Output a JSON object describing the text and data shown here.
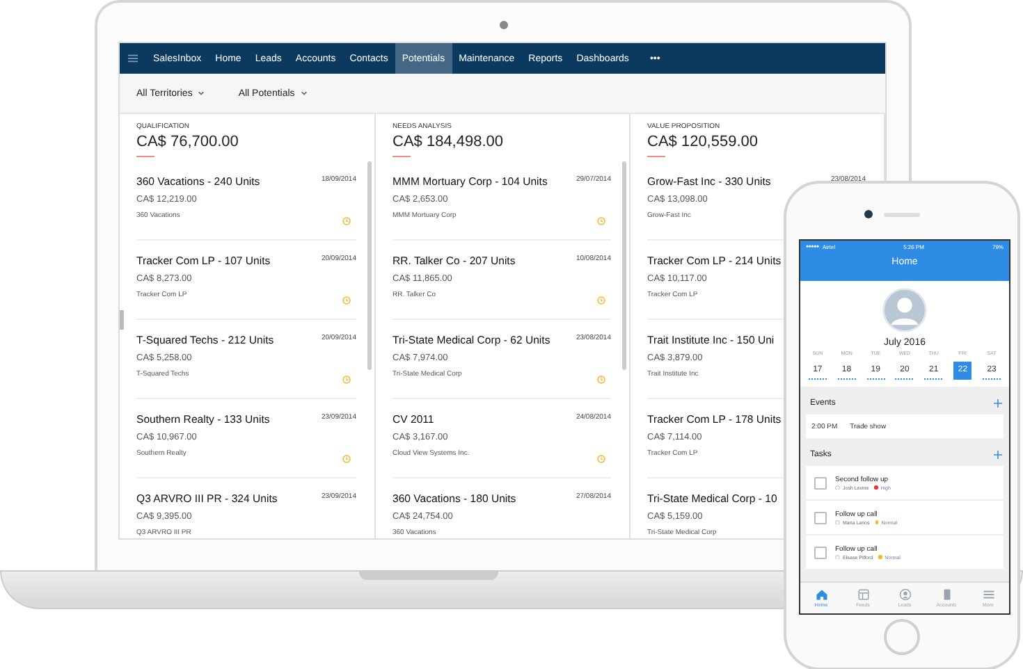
{
  "crm": {
    "brand": "SalesInbox",
    "more": "•••",
    "nav": [
      {
        "label": "Home",
        "selected": false
      },
      {
        "label": "Leads",
        "selected": false
      },
      {
        "label": "Accounts",
        "selected": false
      },
      {
        "label": "Contacts",
        "selected": false
      },
      {
        "label": "Potentials",
        "selected": true
      },
      {
        "label": "Maintenance",
        "selected": false
      },
      {
        "label": "Reports",
        "selected": false
      },
      {
        "label": "Dashboards",
        "selected": false
      }
    ],
    "filters": [
      "All Territories",
      "All Potentials"
    ],
    "columns": [
      {
        "stage": "QUALIFICATION",
        "total": "CA$ 76,700.00",
        "cards": [
          {
            "title": "360 Vacations - 240 Units",
            "amount": "CA$ 12,219.00",
            "account": "360 Vacations",
            "date": "18/09/2014",
            "reminder": true
          },
          {
            "title": "Tracker Com LP - 107 Units",
            "amount": "CA$ 8,273.00",
            "account": "Tracker Com LP",
            "date": "20/09/2014",
            "reminder": true
          },
          {
            "title": "T-Squared Techs - 212 Units",
            "amount": "CA$ 5,258.00",
            "account": "T-Squared Techs",
            "date": "20/09/2014",
            "reminder": true
          },
          {
            "title": "Southern Realty - 133 Units",
            "amount": "CA$ 10,967.00",
            "account": "Southern Realty",
            "date": "23/09/2014",
            "reminder": true
          },
          {
            "title": "Q3 ARVRO III PR - 324 Units",
            "amount": "CA$ 9,395.00",
            "account": "Q3 ARVRO III PR",
            "date": "23/09/2014"
          }
        ]
      },
      {
        "stage": "NEEDS ANALYSIS",
        "total": "CA$ 184,498.00",
        "cards": [
          {
            "title": "MMM Mortuary Corp - 104 Units",
            "amount": "CA$ 2,653.00",
            "account": "MMM Mortuary Corp",
            "date": "29/07/2014",
            "reminder": true
          },
          {
            "title": "RR. Talker Co - 207 Units",
            "amount": "CA$ 11,865.00",
            "account": "RR. Talker Co",
            "date": "10/08/2014",
            "reminder": true
          },
          {
            "title": "Tri-State Medical Corp - 62 Units",
            "amount": "CA$ 7,974.00",
            "account": "Tri-State Medical Corp",
            "date": "23/08/2014",
            "reminder": true
          },
          {
            "title": "CV 2011",
            "amount": "CA$ 3,167.00",
            "account": "Cloud View Systems Inc.",
            "date": "24/08/2014",
            "reminder": true
          },
          {
            "title": "360 Vacations - 180 Units",
            "amount": "CA$ 24,754.00",
            "account": "360 Vacations",
            "date": "27/08/2014"
          }
        ]
      },
      {
        "stage": "VALUE PROPOSITION",
        "total": "CA$ 120,559.00",
        "cards": [
          {
            "title": "Grow-Fast Inc - 330 Units",
            "amount": "CA$ 13,098.00",
            "account": "Grow-Fast Inc",
            "date": "23/08/2014"
          },
          {
            "title": "Tracker Com LP - 214 Units",
            "amount": "CA$ 10,117.00",
            "account": "Tracker Com LP"
          },
          {
            "title": "Trait Institute Inc - 150 Uni",
            "amount": "CA$ 3,879.00",
            "account": "Trait Institute Inc"
          },
          {
            "title": "Tracker Com LP - 178 Units",
            "amount": "CA$ 7,114.00",
            "account": "Tracker Com LP"
          },
          {
            "title": "Tri-State Medical Corp - 10",
            "amount": "CA$ 5,159.00",
            "account": "Tri-State Medical Corp"
          }
        ]
      }
    ]
  },
  "phone": {
    "carrier": "Airtel",
    "time": "5:26 PM",
    "battery": "79%",
    "title": "Home",
    "month": "July 2016",
    "days": [
      {
        "weekday": "SUN",
        "date": "17",
        "selected": false
      },
      {
        "weekday": "MON",
        "date": "18",
        "selected": false
      },
      {
        "weekday": "TUE",
        "date": "19",
        "selected": false
      },
      {
        "weekday": "WED",
        "date": "20",
        "selected": false
      },
      {
        "weekday": "THU",
        "date": "21",
        "selected": false
      },
      {
        "weekday": "FRI",
        "date": "22",
        "selected": true
      },
      {
        "weekday": "SAT",
        "date": "23",
        "selected": false
      }
    ],
    "events_title": "Events",
    "events": [
      {
        "time": "2:00 PM",
        "name": "Trade show"
      }
    ],
    "tasks_title": "Tasks",
    "tasks": [
      {
        "title": "Second follow up",
        "owner": "Josh Levine",
        "priority": "High",
        "color": "#e8323c",
        "checked": false
      },
      {
        "title": "Follow up call",
        "owner": "Maria Larios",
        "priority": "Normal",
        "color": "#f5b72a",
        "checked": false
      },
      {
        "title": "Follow up call",
        "owner": "Elease Pilford",
        "priority": "Normal",
        "color": "#f5b72a",
        "checked": false
      }
    ],
    "tabs": [
      {
        "label": "Home",
        "kind": "home",
        "selected": true
      },
      {
        "label": "Feeds",
        "kind": "feeds",
        "selected": false
      },
      {
        "label": "Leads",
        "kind": "leads",
        "selected": false
      },
      {
        "label": "Accounts",
        "kind": "accounts",
        "selected": false
      },
      {
        "label": "More",
        "kind": "more",
        "selected": false
      }
    ]
  }
}
